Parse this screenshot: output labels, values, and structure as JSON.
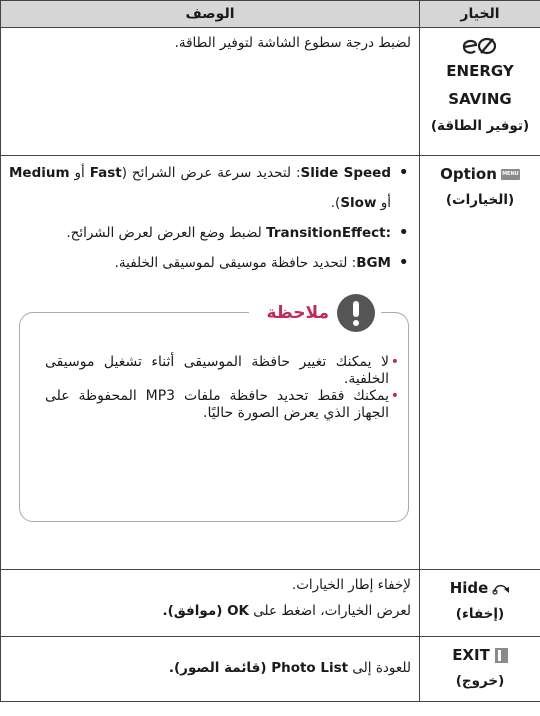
{
  "header": {
    "option_col": "الخيار",
    "desc_col": "الوصف"
  },
  "rows": {
    "energy": {
      "icon": "energy-saving-icon",
      "name_en": "ENERGY SAVING",
      "name_ar": "(توفير الطاقة)",
      "desc": "لضبط درجة سطوع الشاشة لتوفير الطاقة."
    },
    "option": {
      "icon": "menu-icon",
      "icon_text": "MENU",
      "name_en": "Option",
      "name_ar": "(الخيارات)",
      "bullets": [
        {
          "key": "Slide Speed",
          "text": ": لتحديد سرعة عرض الشرائح (",
          "o1": "Fast",
          "sep": " أو ",
          "o2": "Medium",
          "sep2": " أو ",
          "o3": "Slow",
          "end": ")."
        },
        {
          "key": "TransitionEffect:",
          "text": " لضبط وضع العرض لعرض الشرائح."
        },
        {
          "key": "BGM",
          "text": ": لتحديد حافظة موسيقى لموسيقى الخلفية."
        }
      ],
      "note": {
        "title": "ملاحظة",
        "items": [
          "لا يمكنك تغيير حافظة الموسيقى أثناء تشغيل موسيقى الخلفية.",
          "يمكنك فقط تحديد حافظة ملفات MP3 المحفوظة على الجهاز الذي يعرض الصورة حاليًا."
        ]
      }
    },
    "hide": {
      "icon": "back-arrow-icon",
      "name_en": "Hide",
      "name_ar": "(إخفاء)",
      "line1": "لإخفاء إطار الخيارات.",
      "line2_pre": "لعرض الخيارات، اضغط على ",
      "line2_ok": "OK",
      "line2_post": " (موافق)."
    },
    "exit": {
      "icon": "exit-icon",
      "name_en": "EXIT",
      "name_ar": "(خروج)",
      "pre": "للعودة إلى ",
      "bold": "Photo List",
      "post": " (قائمة الصور)."
    }
  }
}
